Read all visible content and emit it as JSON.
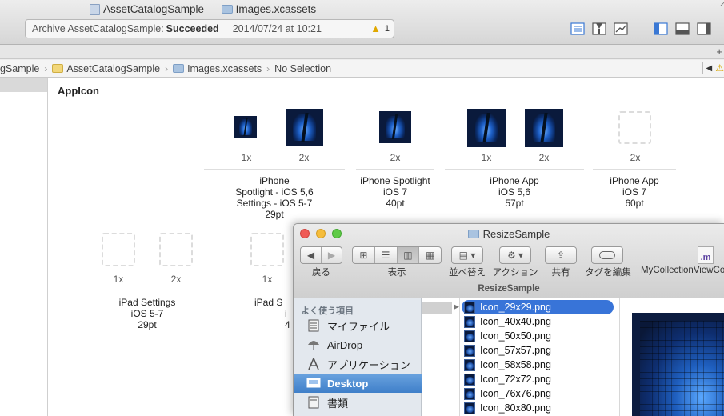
{
  "xcode": {
    "title_project": "AssetCatalogSample",
    "title_separator": "—",
    "title_file": "Images.xcassets",
    "status": {
      "prefix": "Archive AssetCatalogSample:",
      "result": "Succeeded",
      "timestamp": "2014/07/24 at 10:21",
      "warning_count": "1"
    },
    "jumpbar": {
      "items": [
        "gSample",
        "AssetCatalogSample",
        "Images.xcassets",
        "No Selection"
      ],
      "right_warning": "⚠"
    },
    "asset_title": "AppIcon",
    "groups_row1": [
      {
        "lines": [
          "iPhone",
          "Spotlight - iOS 5,6",
          "Settings - iOS 5-7",
          "29pt"
        ],
        "scales": [
          "1x",
          "2x"
        ]
      },
      {
        "lines": [
          "iPhone Spotlight",
          "iOS 7",
          "40pt"
        ],
        "scales": [
          "2x"
        ]
      },
      {
        "lines": [
          "iPhone App",
          "iOS 5,6",
          "57pt"
        ],
        "scales": [
          "1x",
          "2x"
        ]
      },
      {
        "lines": [
          "iPhone App",
          "iOS 7",
          "60pt"
        ],
        "scales": [
          "2x"
        ]
      }
    ],
    "groups_row2": [
      {
        "lines": [
          "iPad Settings",
          "iOS 5-7",
          "29pt"
        ],
        "scales": [
          "1x",
          "2x"
        ]
      },
      {
        "lines": [
          "iPad S",
          "i",
          "4"
        ],
        "scales": [
          "1x"
        ]
      }
    ]
  },
  "finder": {
    "title": "ResizeSample",
    "path_title": "ResizeSample",
    "toolbar": {
      "back_label": "戻る",
      "view_label": "表示",
      "arrange_label": "並べ替え",
      "action_label": "アクション",
      "share_label": "共有",
      "tag_label": "タグを編集",
      "file_label": "MyCollectionViewCo",
      "file_badge": ".m"
    },
    "sidebar_header": "よく使う項目",
    "sidebar_items": [
      {
        "label": "マイファイル",
        "icon": "all-files-icon"
      },
      {
        "label": "AirDrop",
        "icon": "airdrop-icon"
      },
      {
        "label": "アプリケーション",
        "icon": "applications-icon"
      },
      {
        "label": "Desktop",
        "icon": "desktop-icon"
      },
      {
        "label": "書類",
        "icon": "documents-icon"
      }
    ],
    "files": [
      "Icon_29x29.png",
      "Icon_40x40.png",
      "Icon_50x50.png",
      "Icon_57x57.png",
      "Icon_58x58.png",
      "Icon_72x72.png",
      "Icon_76x76.png",
      "Icon_80x80.png"
    ]
  }
}
